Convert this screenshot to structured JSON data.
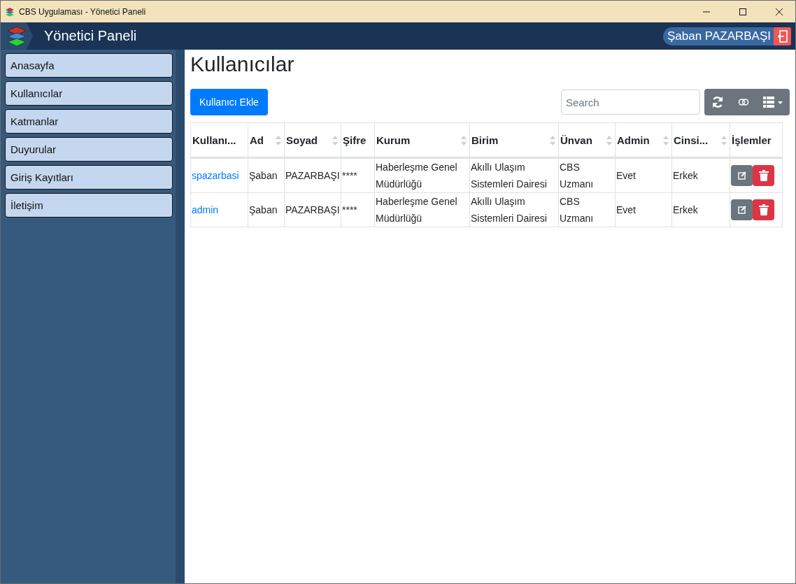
{
  "window": {
    "title": "CBS Uygulaması - Yönetici Paneli"
  },
  "header": {
    "title": "Yönetici Paneli",
    "user": "Şaban PAZARBAŞI"
  },
  "sidebar": {
    "items": [
      {
        "label": "Anasayfa",
        "selected": false
      },
      {
        "label": "Kullanıcılar",
        "selected": false
      },
      {
        "label": "Katmanlar",
        "selected": false
      },
      {
        "label": "Duyurular",
        "selected": false
      },
      {
        "label": "Giriş Kayıtları",
        "selected": false
      },
      {
        "label": "İletişim",
        "selected": false
      }
    ]
  },
  "page": {
    "title": "Kullanıcılar",
    "add_button": "Kullanıcı Ekle",
    "search": {
      "placeholder": "Search"
    }
  },
  "table": {
    "columns": [
      {
        "label": "Kullanı...",
        "sortable": false
      },
      {
        "label": "Ad",
        "sortable": true
      },
      {
        "label": "Soyad",
        "sortable": true
      },
      {
        "label": "Şifre",
        "sortable": false
      },
      {
        "label": "Kurum",
        "sortable": true
      },
      {
        "label": "Birim",
        "sortable": true
      },
      {
        "label": "Ünvan",
        "sortable": true
      },
      {
        "label": "Admin",
        "sortable": true
      },
      {
        "label": "Cinsi...",
        "sortable": true
      },
      {
        "label": "İşlemler",
        "sortable": false
      }
    ],
    "rows": [
      {
        "cells": [
          "spazarbasi",
          "Şaban",
          "PAZARBAŞI",
          "****",
          "Haberleşme Genel Müdürlüğü",
          "Akıllı Ulaşım Sistemleri Dairesi",
          "CBS Uzmanı",
          "Evet",
          "Erkek"
        ]
      },
      {
        "cells": [
          "admin",
          "Şaban",
          "PAZARBAŞI",
          "****",
          "Haberleşme Genel Müdürlüğü",
          "Akıllı Ulaşım Sistemleri Dairesi",
          "CBS Uzmanı",
          "Evet",
          "Erkek"
        ]
      }
    ]
  }
}
